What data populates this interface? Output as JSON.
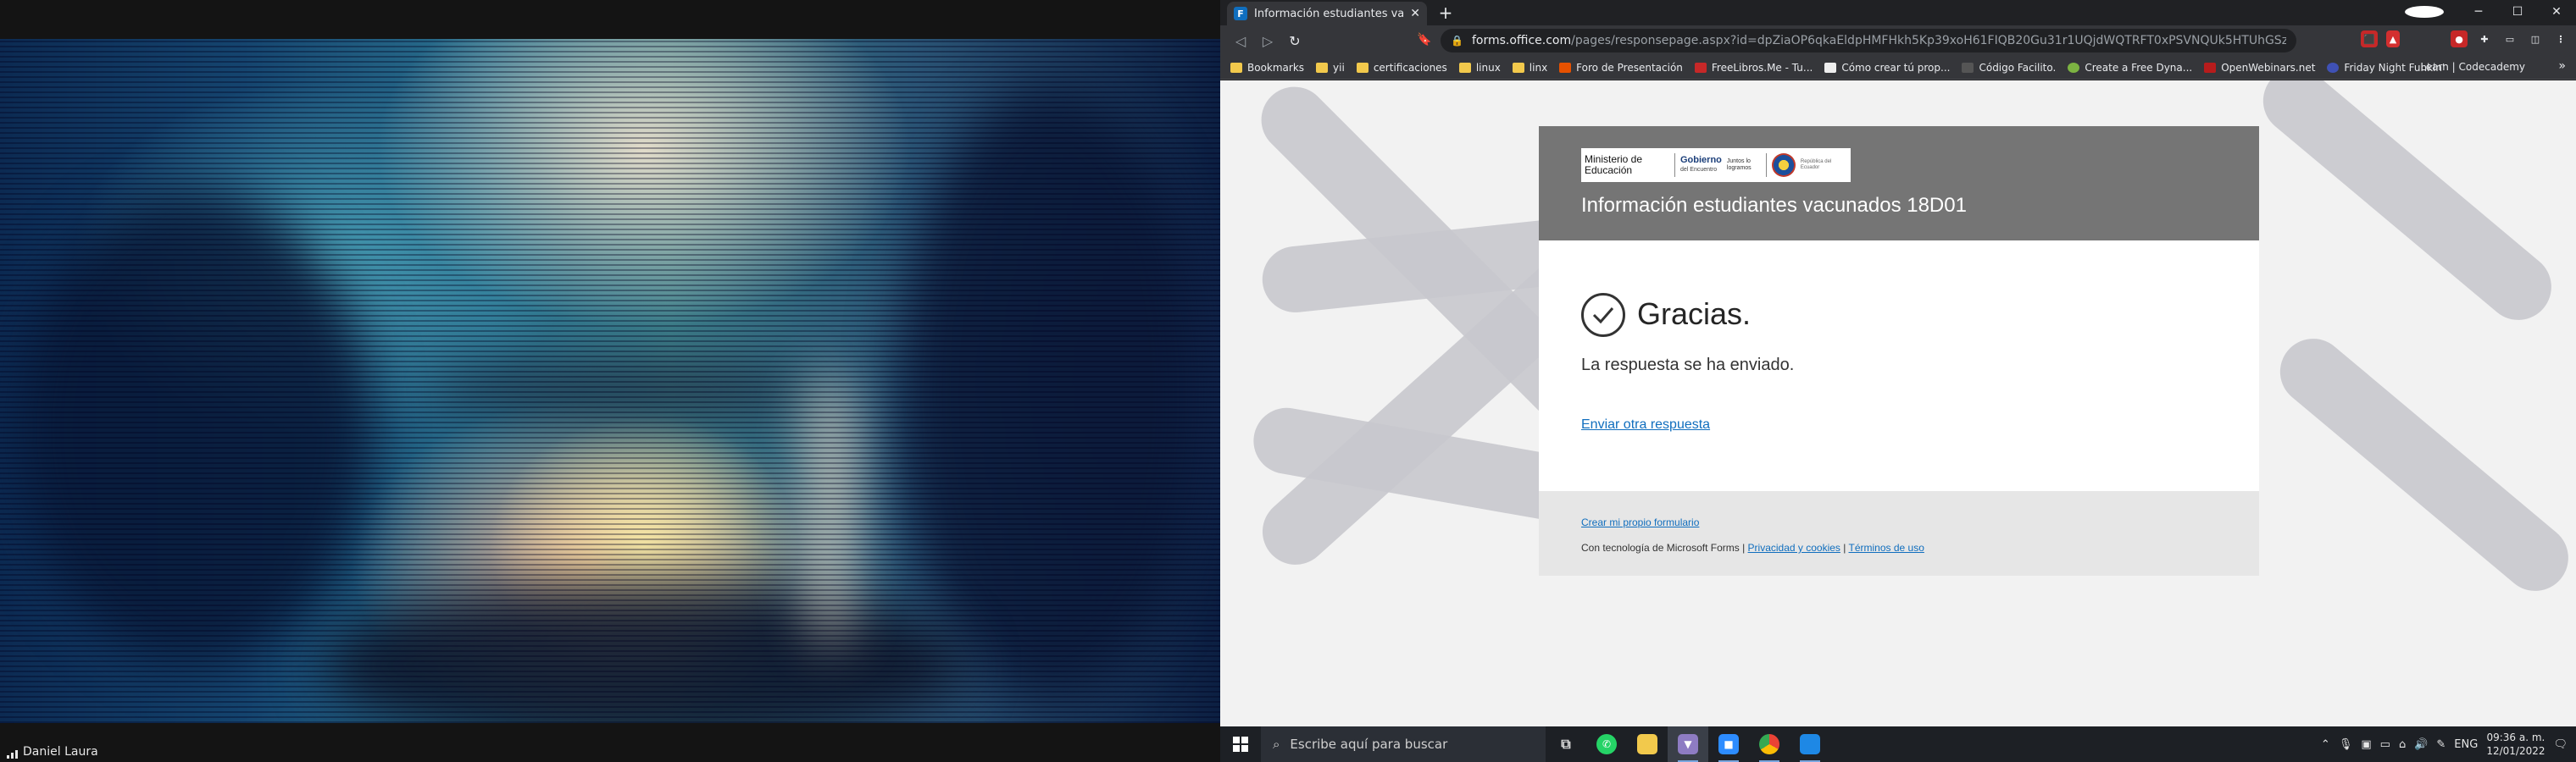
{
  "video": {
    "participant_name": "Daniel Laura"
  },
  "browser": {
    "tab": {
      "title": "Información estudiantes vacunad",
      "favicon_letter": "F"
    },
    "url": {
      "host": "forms.office.com",
      "path": "/pages/responsepage.aspx?id=dpZiaOP6qkaEldpHMFHkh5Kp39xoH61FIQB20Gu31r1UQjdWQTRFT0xPSVNQUk5HTUhGSzRBVFlLOS4u"
    },
    "bookmarks": [
      {
        "label": "Bookmarks",
        "icon": "folder-icon"
      },
      {
        "label": "yii",
        "icon": "folder-icon"
      },
      {
        "label": "certificaciones",
        "icon": "folder-icon"
      },
      {
        "label": "linux",
        "icon": "folder-icon"
      },
      {
        "label": "linx",
        "icon": "folder-icon"
      },
      {
        "label": "Foro de Presentación",
        "icon": "site-icon"
      },
      {
        "label": "FreeLibros.Me - Tu...",
        "icon": "site-icon"
      },
      {
        "label": "Cómo crear tú prop...",
        "icon": "site-icon"
      },
      {
        "label": "Código Facilito.",
        "icon": "site-icon"
      },
      {
        "label": "Create a Free Dyna...",
        "icon": "site-icon"
      },
      {
        "label": "OpenWebinars.net",
        "icon": "site-icon"
      },
      {
        "label": "Friday Night Funkin'",
        "icon": "site-icon"
      }
    ],
    "bookmark_right": "Learn | Codecademy"
  },
  "form": {
    "logo": {
      "ministerio": "Ministerio de Educación",
      "gobierno": "Gobierno",
      "gobierno_sub": "del Encuentro",
      "juntos": "Juntos lo logramos",
      "republica": "República del Ecuador"
    },
    "title": "Información estudiantes vacunados 18D01",
    "thanks": "Gracias.",
    "sent_message": "La respuesta se ha enviado.",
    "submit_another": "Enviar otra respuesta",
    "create_own": "Crear mi propio formulario",
    "powered_by": "Con tecnología de Microsoft Forms |",
    "privacy": "Privacidad y cookies",
    "terms": "Términos de uso"
  },
  "taskbar": {
    "search_placeholder": "Escribe aquí para buscar",
    "language": "ENG",
    "time": "09:36 a. m.",
    "date": "12/01/2022"
  },
  "colors": {
    "forms_header": "#757575",
    "link": "#106ebe",
    "page_bg": "#f2f2f2"
  }
}
